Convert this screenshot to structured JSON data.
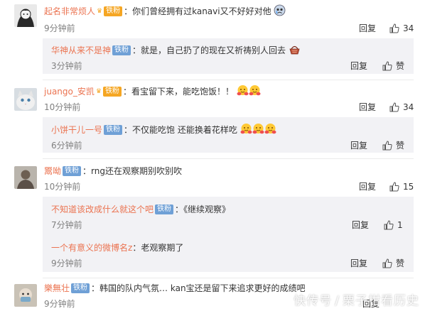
{
  "colors": {
    "username": "#eb7350",
    "badge": "#6fa0d6",
    "badge_gold": "#f5a623",
    "reply_bg": "#f2f2f5",
    "time": "#808080"
  },
  "labels": {
    "reply": "回复",
    "like": "赞"
  },
  "comments": [
    {
      "user": "起名非常烦人",
      "badge": "铁粉",
      "sep": "：",
      "text": "你们曾经拥有过kanavi又不好好对他",
      "emoji": "sad-face",
      "time": "9分钟前",
      "likes": "34",
      "replies": [
        {
          "user": "华神从来不是神",
          "badge": "铁粉",
          "sep": "：",
          "text": "就是，自己扔了的现在又祈祷别人回去",
          "emoji": "basket",
          "time": "3分钟前",
          "likes": "赞"
        }
      ]
    },
    {
      "user": "juango_安凯",
      "badge": "铁粉",
      "sep": "：",
      "text": "看宝留下来，能吃饱饭！！",
      "emoji": "hug-face ×2",
      "time": "10分钟前",
      "likes": "34",
      "replies": [
        {
          "user": "小饼干儿一号",
          "badge": "铁粉",
          "sep": "：",
          "text": "不仅能吃饱 还能换着花样吃",
          "emoji": "hug-face ×3",
          "time": "6分钟前",
          "likes": "赞"
        }
      ]
    },
    {
      "user": "鬻呦",
      "badge": "铁粉",
      "sep": "：",
      "text": "rng还在观察期别吹别吹",
      "time": "10分钟前",
      "likes": "15",
      "replies": [
        {
          "user": "不知道该改成什么就这个吧",
          "badge": "铁粉",
          "sep": "：",
          "text": "《继续观察》",
          "time": "7分钟前",
          "likes": "1"
        },
        {
          "user": "一个有意义的微博名z",
          "sep": "：",
          "text": "老观察期了",
          "time": "9分钟前",
          "likes": "赞"
        }
      ]
    },
    {
      "user": "樂無壮",
      "badge": "铁粉",
      "sep": "：",
      "text": "韩国的队内气氛… kan宝还是留下来追求更好的成绩吧",
      "time": "9分钟前"
    }
  ],
  "watermark": {
    "source": "快传号",
    "separator": "/",
    "author": "栗子柑看历史"
  }
}
